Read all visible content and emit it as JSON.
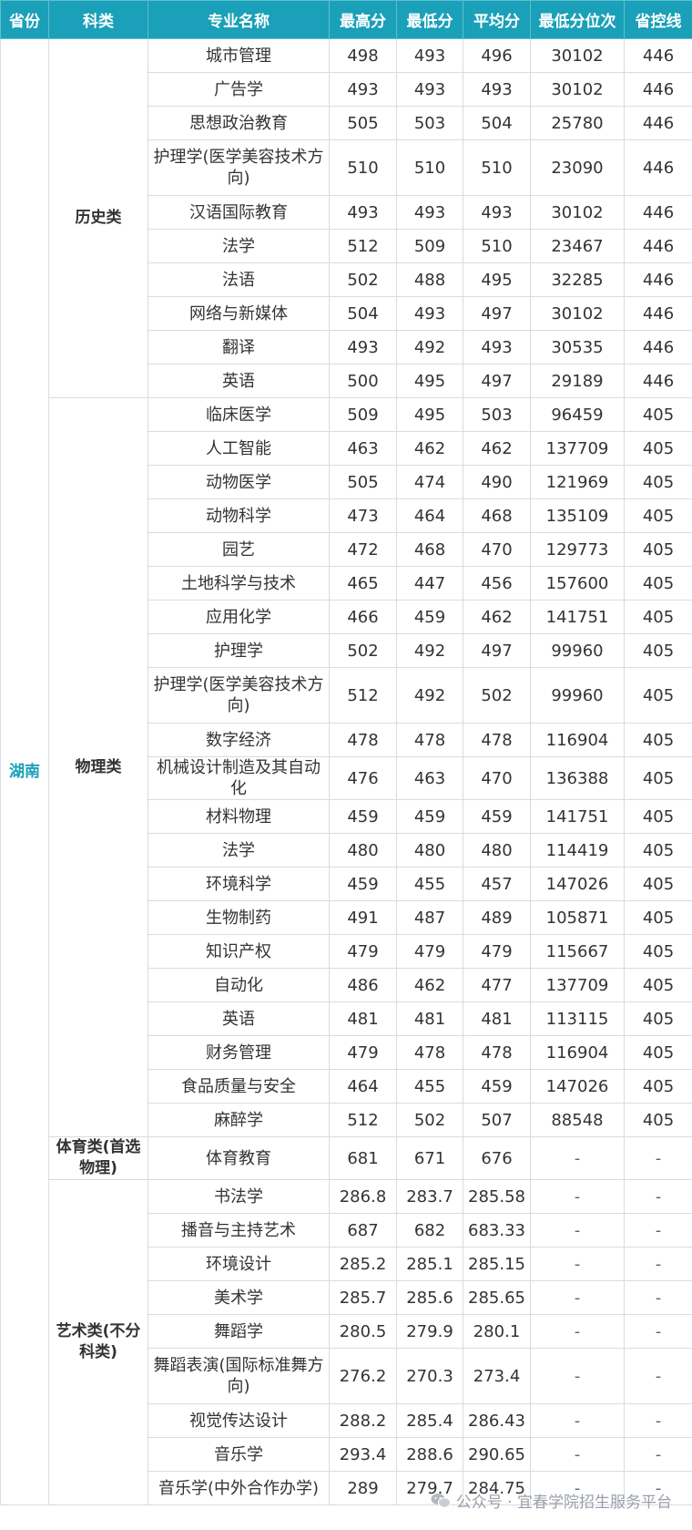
{
  "headers": [
    "省份",
    "科类",
    "专业名称",
    "最高分",
    "最低分",
    "平均分",
    "最低分位次",
    "省控线"
  ],
  "province": "湖南",
  "groups": [
    {
      "category": "历史类",
      "rows": [
        {
          "major": "城市管理",
          "max": "498",
          "min": "493",
          "avg": "496",
          "rank": "30102",
          "line": "446"
        },
        {
          "major": "广告学",
          "max": "493",
          "min": "493",
          "avg": "493",
          "rank": "30102",
          "line": "446"
        },
        {
          "major": "思想政治教育",
          "max": "505",
          "min": "503",
          "avg": "504",
          "rank": "25780",
          "line": "446"
        },
        {
          "major": "护理学(医学美容技术方向)",
          "max": "510",
          "min": "510",
          "avg": "510",
          "rank": "23090",
          "line": "446"
        },
        {
          "major": "汉语国际教育",
          "max": "493",
          "min": "493",
          "avg": "493",
          "rank": "30102",
          "line": "446"
        },
        {
          "major": "法学",
          "max": "512",
          "min": "509",
          "avg": "510",
          "rank": "23467",
          "line": "446"
        },
        {
          "major": "法语",
          "max": "502",
          "min": "488",
          "avg": "495",
          "rank": "32285",
          "line": "446"
        },
        {
          "major": "网络与新媒体",
          "max": "504",
          "min": "493",
          "avg": "497",
          "rank": "30102",
          "line": "446"
        },
        {
          "major": "翻译",
          "max": "493",
          "min": "492",
          "avg": "493",
          "rank": "30535",
          "line": "446"
        },
        {
          "major": "英语",
          "max": "500",
          "min": "495",
          "avg": "497",
          "rank": "29189",
          "line": "446"
        }
      ]
    },
    {
      "category": "物理类",
      "rows": [
        {
          "major": "临床医学",
          "max": "509",
          "min": "495",
          "avg": "503",
          "rank": "96459",
          "line": "405"
        },
        {
          "major": "人工智能",
          "max": "463",
          "min": "462",
          "avg": "462",
          "rank": "137709",
          "line": "405"
        },
        {
          "major": "动物医学",
          "max": "505",
          "min": "474",
          "avg": "490",
          "rank": "121969",
          "line": "405"
        },
        {
          "major": "动物科学",
          "max": "473",
          "min": "464",
          "avg": "468",
          "rank": "135109",
          "line": "405"
        },
        {
          "major": "园艺",
          "max": "472",
          "min": "468",
          "avg": "470",
          "rank": "129773",
          "line": "405"
        },
        {
          "major": "土地科学与技术",
          "max": "465",
          "min": "447",
          "avg": "456",
          "rank": "157600",
          "line": "405"
        },
        {
          "major": "应用化学",
          "max": "466",
          "min": "459",
          "avg": "462",
          "rank": "141751",
          "line": "405"
        },
        {
          "major": "护理学",
          "max": "502",
          "min": "492",
          "avg": "497",
          "rank": "99960",
          "line": "405"
        },
        {
          "major": "护理学(医学美容技术方向)",
          "max": "512",
          "min": "492",
          "avg": "502",
          "rank": "99960",
          "line": "405"
        },
        {
          "major": "数字经济",
          "max": "478",
          "min": "478",
          "avg": "478",
          "rank": "116904",
          "line": "405"
        },
        {
          "major": "机械设计制造及其自动化",
          "max": "476",
          "min": "463",
          "avg": "470",
          "rank": "136388",
          "line": "405"
        },
        {
          "major": "材料物理",
          "max": "459",
          "min": "459",
          "avg": "459",
          "rank": "141751",
          "line": "405"
        },
        {
          "major": "法学",
          "max": "480",
          "min": "480",
          "avg": "480",
          "rank": "114419",
          "line": "405"
        },
        {
          "major": "环境科学",
          "max": "459",
          "min": "455",
          "avg": "457",
          "rank": "147026",
          "line": "405"
        },
        {
          "major": "生物制药",
          "max": "491",
          "min": "487",
          "avg": "489",
          "rank": "105871",
          "line": "405"
        },
        {
          "major": "知识产权",
          "max": "479",
          "min": "479",
          "avg": "479",
          "rank": "115667",
          "line": "405"
        },
        {
          "major": "自动化",
          "max": "486",
          "min": "462",
          "avg": "477",
          "rank": "137709",
          "line": "405"
        },
        {
          "major": "英语",
          "max": "481",
          "min": "481",
          "avg": "481",
          "rank": "113115",
          "line": "405"
        },
        {
          "major": "财务管理",
          "max": "479",
          "min": "478",
          "avg": "478",
          "rank": "116904",
          "line": "405"
        },
        {
          "major": "食品质量与安全",
          "max": "464",
          "min": "455",
          "avg": "459",
          "rank": "147026",
          "line": "405"
        },
        {
          "major": "麻醉学",
          "max": "512",
          "min": "502",
          "avg": "507",
          "rank": "88548",
          "line": "405"
        }
      ]
    },
    {
      "category": "体育类(首选物理)",
      "rows": [
        {
          "major": "体育教育",
          "max": "681",
          "min": "671",
          "avg": "676",
          "rank": "-",
          "line": "-"
        }
      ]
    },
    {
      "category": "艺术类(不分科类)",
      "rows": [
        {
          "major": "书法学",
          "max": "286.8",
          "min": "283.7",
          "avg": "285.58",
          "rank": "-",
          "line": "-"
        },
        {
          "major": "播音与主持艺术",
          "max": "687",
          "min": "682",
          "avg": "683.33",
          "rank": "-",
          "line": "-"
        },
        {
          "major": "环境设计",
          "max": "285.2",
          "min": "285.1",
          "avg": "285.15",
          "rank": "-",
          "line": "-"
        },
        {
          "major": "美术学",
          "max": "285.7",
          "min": "285.6",
          "avg": "285.65",
          "rank": "-",
          "line": "-"
        },
        {
          "major": "舞蹈学",
          "max": "280.5",
          "min": "279.9",
          "avg": "280.1",
          "rank": "-",
          "line": "-"
        },
        {
          "major": "舞蹈表演(国际标准舞方向)",
          "max": "276.2",
          "min": "270.3",
          "avg": "273.4",
          "rank": "-",
          "line": "-"
        },
        {
          "major": "视觉传达设计",
          "max": "288.2",
          "min": "285.4",
          "avg": "286.43",
          "rank": "-",
          "line": "-"
        },
        {
          "major": "音乐学",
          "max": "293.4",
          "min": "288.6",
          "avg": "290.65",
          "rank": "-",
          "line": "-"
        },
        {
          "major": "音乐学(中外合作办学)",
          "max": "289",
          "min": "279.7",
          "avg": "284.75",
          "rank": "-",
          "line": "-"
        }
      ]
    }
  ],
  "watermark": {
    "text": "公众号 · 宜春学院招生服务平台",
    "icon": "wechat-icon"
  }
}
